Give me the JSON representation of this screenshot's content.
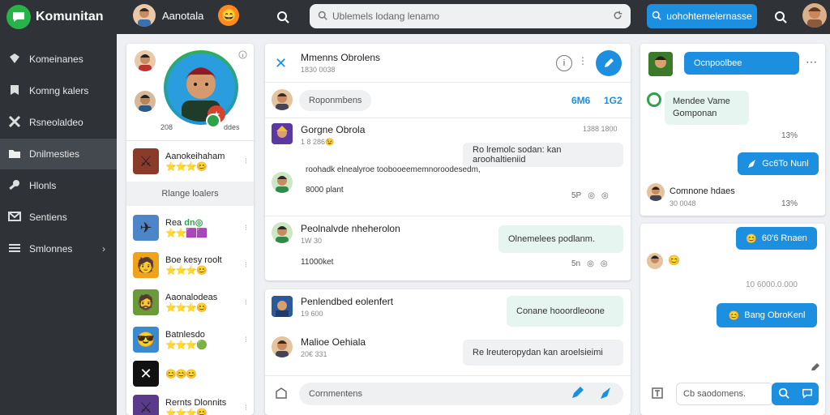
{
  "app": {
    "name": "Komunitan"
  },
  "topbar": {
    "user_name": "Aanotala",
    "search_placeholder": "Ublemels lodang lenamo",
    "cta_label": "uohohtemelernasse"
  },
  "sidebar": {
    "items": [
      {
        "label": "Komeinanes",
        "icon": "gem-icon"
      },
      {
        "label": "Komng kalers",
        "icon": "bookmark-icon"
      },
      {
        "label": "Rsneolaldeo",
        "icon": "tools-icon"
      },
      {
        "label": "Dnilmesties",
        "icon": "folder-icon",
        "active": true
      },
      {
        "label": "Hlonls",
        "icon": "wrench-icon"
      },
      {
        "label": "Sentiens",
        "icon": "mail-icon"
      },
      {
        "label": "Smlonnes",
        "icon": "list-icon",
        "chevron": true
      }
    ]
  },
  "left_panel": {
    "hero_label_left": "208",
    "hero_label_right": "ddes",
    "top_item": {
      "name": "Aanokeihaham",
      "stars": "⭐⭐⭐😊"
    },
    "section_label": "Rlange loalers",
    "items": [
      {
        "name": "Rea",
        "tag": "dn◎",
        "stars": "⭐⭐🟪🟪"
      },
      {
        "name": "Boe kesy roolt",
        "stars": "⭐⭐⭐😊"
      },
      {
        "name": "Aaonalodeas",
        "stars": "⭐⭐⭐😊"
      },
      {
        "name": "Batnlesdo",
        "stars": "⭐⭐⭐🟢"
      },
      {
        "name": "",
        "stars": "😊😊😊"
      },
      {
        "name": "Rernts Dlonnits",
        "stars": "⭐⭐⭐😊"
      }
    ]
  },
  "chat": {
    "title": "Mmenns Obrolens",
    "subtitle": "1830 0038",
    "filter_pill": "Roponmbens",
    "counter_a": "6M6",
    "counter_b": "1G2",
    "thread": {
      "name": "Gorgne Obrola",
      "time": "1388 1800",
      "sub": "1 8 286😉",
      "bubble": "Ro lremolc sodan: kan aroohaltieniid",
      "body_line1": "roohadk elnealyroe toobooeememnoroodesedm,",
      "body_line2": "8000 plant",
      "meta_a": "5P",
      "meta_b": "◎",
      "meta_c": "◎"
    },
    "message_2": {
      "name": "Peolnalvde nheherolon",
      "sub": "1W 30",
      "body": "11000ket",
      "bubble": "Olnemelees podlanm.",
      "meta_a": "5n",
      "meta_b": "◎",
      "meta_c": "◎"
    }
  },
  "chat2": {
    "message_1": {
      "name": "Penlendbed eolenfert",
      "sub": "19 600",
      "bubble": "Conane hooordleoone"
    },
    "message_2": {
      "name": "Malioe Oehiala",
      "sub": "20€ 331",
      "bubble": "Re lreuteropydan kan aroelsieimi"
    },
    "composer_placeholder": "Cornmentens"
  },
  "right_top": {
    "header_bubble": "Ocnpoolbee",
    "mint_line1": "Mendee Vame",
    "mint_line2": "Gomponan",
    "meta_1": "13%",
    "blue_btn": "Gc6To Nunl",
    "user_name": "Comnone hdaes",
    "user_sub": "30 0048",
    "meta_2": "13%"
  },
  "right_bottom": {
    "blue_1": "60'6 Rnaen",
    "emoji_row": "😊",
    "status": "10 6000.0.000",
    "blue_2": "Bang ObroKenl",
    "compose_placeholder": "Cb saodomens."
  }
}
